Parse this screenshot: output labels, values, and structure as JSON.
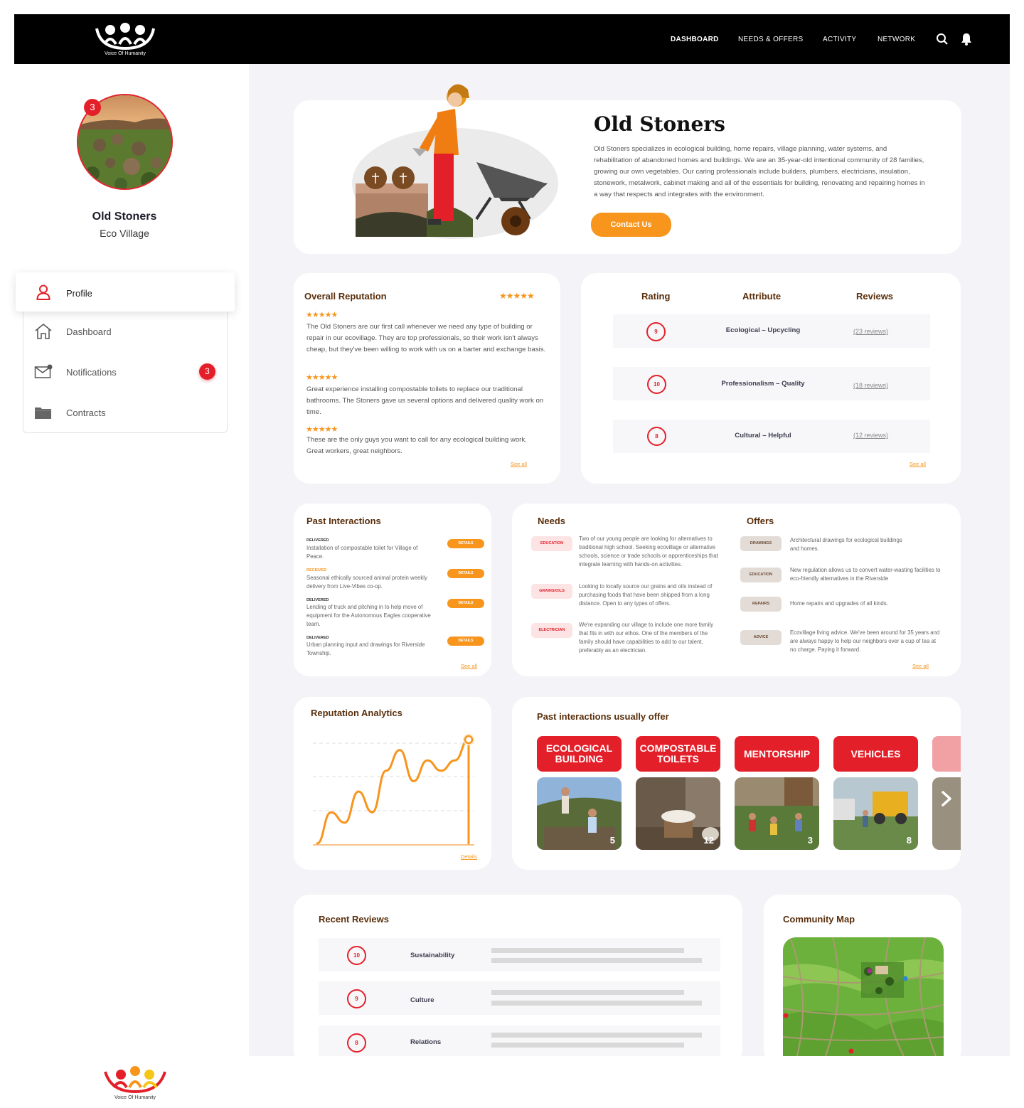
{
  "header": {
    "brand": "Voice Of Humanity",
    "nav": [
      "DASHBOARD",
      "NEEDS & OFFERS",
      "ACTIVITY",
      "NETWORK"
    ],
    "icons": [
      "search-icon",
      "bell-icon"
    ]
  },
  "sidebar": {
    "avatar_badge": "3",
    "org_name": "Old Stoners",
    "org_type": "Eco Village",
    "menu": [
      {
        "label": "Profile",
        "icon": "user-icon"
      },
      {
        "label": "Dashboard",
        "icon": "home-icon"
      },
      {
        "label": "Notifications",
        "icon": "mail-icon",
        "badge": "3"
      },
      {
        "label": "Contracts",
        "icon": "folder-icon"
      }
    ]
  },
  "hero": {
    "title": "Old Stoners",
    "description": "Old Stoners specializes in ecological building, home repairs, village planning, water systems, and rehabilitation of abandoned homes and buildings. We are an 35-year-old intentional community of 28 families, growing our own vegetables. Our caring professionals include builders, plumbers, electricians, insulation, stonework, metalwork, cabinet making and all of the essentials for building, renovating and repairing homes in a way that respects and integrates with the environment.",
    "contact_label": "Contact Us"
  },
  "reputation": {
    "title": "Overall Reputation",
    "stars": "★★★★★",
    "reviews": [
      {
        "stars": "★★★★★",
        "text": "The Old Stoners are our first call whenever we need any type of building or repair in our ecovillage. They are top professionals, so their work isn't always cheap, but they've been willing to work with us on a barter and exchange basis."
      },
      {
        "stars": "★★★★★",
        "text": "Great experience installing compostable toilets to replace our traditional bathrooms. The Stoners gave us several options and delivered quality work on time."
      },
      {
        "stars": "★★★★★",
        "text": "These are the only guys you want to call for any ecological building work. Great workers, great neighbors."
      }
    ],
    "see_all": "See all"
  },
  "ratings": {
    "headers": [
      "Rating",
      "Attribute",
      "Reviews"
    ],
    "rows": [
      {
        "rating": "9",
        "attribute": "Ecological – Upcycling",
        "reviews": "(23 reviews)"
      },
      {
        "rating": "10",
        "attribute": "Professionalism – Quality",
        "reviews": "(18 reviews)"
      },
      {
        "rating": "8",
        "attribute": "Cultural – Helpful",
        "reviews": "(12 reviews)"
      }
    ],
    "see_all": "See all"
  },
  "past_interactions": {
    "title": "Past Interactions",
    "items": [
      {
        "status": "DELIVERED",
        "text": "Installation of compostable toilet for Village of Peace.",
        "button": "DETAILS"
      },
      {
        "status": "RECEIVED",
        "text": "Seasonal ethically sourced animal protein weekly delivery from Live-Vibes co-op.",
        "button": "DETAILS"
      },
      {
        "status": "DELIVERED",
        "text": "Lending of truck and pitching in to help move of equipment for the Autonomous Eagles cooperative team.",
        "button": "DETAILS"
      },
      {
        "status": "DELIVERED",
        "text": "Urban planning input and drawings for Riverside Township.",
        "button": "DETAILS"
      }
    ],
    "see_all": "See all"
  },
  "needs": {
    "title": "Needs",
    "items": [
      {
        "tag": "EDUCATION",
        "text": "Two of our young people are looking for alternatives to traditional high school. Seeking ecovillage or alternative schools, science or trade schools or apprenticeships that integrate learning with hands-on activities."
      },
      {
        "tag": "GRAINS/OILS",
        "text": "Looking to locally source our grains and oils instead of purchasing foods that have been shipped from a long distance. Open to any types of offers."
      },
      {
        "tag": "ELECTRICIAN",
        "text": "We're expanding our village to include one more family that fits in with our ethos. One of the members of the family should have capabilities to add to our talent, preferably as an electrician."
      }
    ]
  },
  "offers": {
    "title": "Offers",
    "items": [
      {
        "tag": "DRAWINGS",
        "text": "Architectural drawings for ecological buildings and homes."
      },
      {
        "tag": "EDUCATION",
        "text": "New regulation allows us to convert water-wasting facilities to eco-friendly alternatives in the Riverside"
      },
      {
        "tag": "REPAIRS",
        "text": "Home repairs and upgrades of all kinds."
      },
      {
        "tag": "ADVICE",
        "text": "Ecovillage living advice. We've been around for 35 years and are always happy to help our neighbors over a cup of tea at no charge. Paying it forward."
      }
    ],
    "see_all": "See all"
  },
  "analytics": {
    "title": "Reputation Analytics",
    "details": "Details"
  },
  "chart_data": {
    "type": "line",
    "title": "Reputation Analytics",
    "xlabel": "",
    "ylabel": "",
    "grid": true,
    "values": [
      0,
      3,
      2,
      5,
      3,
      7,
      9,
      6,
      8,
      7,
      8,
      10
    ]
  },
  "usually_offer": {
    "title": "Past interactions usually offer",
    "items": [
      {
        "label": "ECOLOGICAL BUILDING",
        "count": "5"
      },
      {
        "label": "COMPOSTABLE TOILETS",
        "count": "12"
      },
      {
        "label": "MENTORSHIP",
        "count": "3"
      },
      {
        "label": "VEHICLES",
        "count": "8"
      }
    ],
    "next_icon": "chevron-right-icon"
  },
  "recent_reviews": {
    "title": "Recent Reviews",
    "rows": [
      {
        "rating": "10",
        "label": "Sustainability"
      },
      {
        "rating": "9",
        "label": "Culture"
      },
      {
        "rating": "8",
        "label": "Relations"
      }
    ]
  },
  "community_map": {
    "title": "Community Map"
  },
  "footer": {
    "brand": "Voice Of Humanity"
  },
  "colors": {
    "accent_orange": "#f7951d",
    "accent_red": "#e3202a",
    "heading_brown": "#5a2f0c"
  }
}
